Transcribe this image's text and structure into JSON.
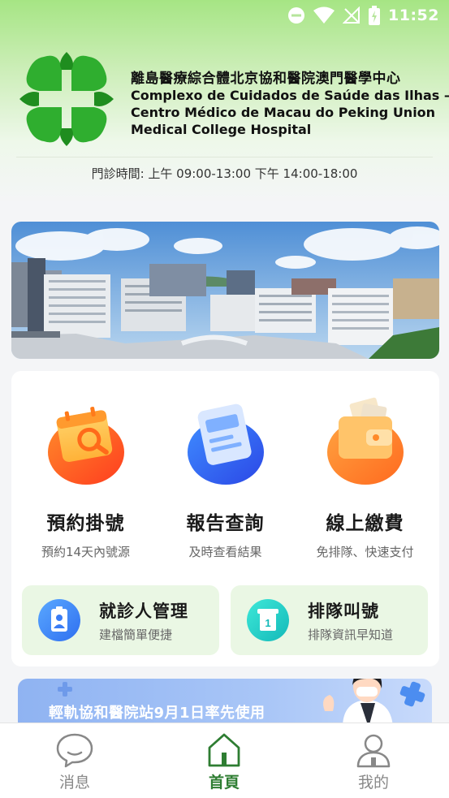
{
  "status_bar": {
    "time": "11:52",
    "icons": [
      "do-not-disturb-icon",
      "wifi-icon",
      "no-signal-icon",
      "battery-charging-icon"
    ]
  },
  "header": {
    "name_zh": "離島醫療綜合體北京協和醫院澳門醫學中心",
    "name_pt_line1": "Complexo de Cuidados de Saúde das Ilhas —",
    "name_pt_line2": "Centro Médico de Macau do Peking Union",
    "name_en_line3": "Medical College Hospital",
    "hours": "門診時間: 上午 09:00-13:00  下午 14:00-18:00",
    "brand_color": "#2fae2f"
  },
  "services": [
    {
      "title": "預約掛號",
      "subtitle": "預約14天內號源",
      "icon": "calendar-search-icon"
    },
    {
      "title": "報告查詢",
      "subtitle": "及時查看結果",
      "icon": "report-document-icon"
    },
    {
      "title": "線上繳費",
      "subtitle": "免排隊、快速支付",
      "icon": "wallet-icon"
    }
  ],
  "mini_services": [
    {
      "title": "就診人管理",
      "subtitle": "建檔簡單便捷",
      "icon": "patient-badge-icon"
    },
    {
      "title": "排隊叫號",
      "subtitle": "排隊資訊早知道",
      "icon": "queue-number-icon"
    }
  ],
  "promo": {
    "text": "輕軌協和醫院站9月1日率先使用"
  },
  "bottom_nav": [
    {
      "label": "消息",
      "icon": "message-icon",
      "active": false
    },
    {
      "label": "首頁",
      "icon": "home-icon",
      "active": true
    },
    {
      "label": "我的",
      "icon": "user-icon",
      "active": false
    }
  ]
}
